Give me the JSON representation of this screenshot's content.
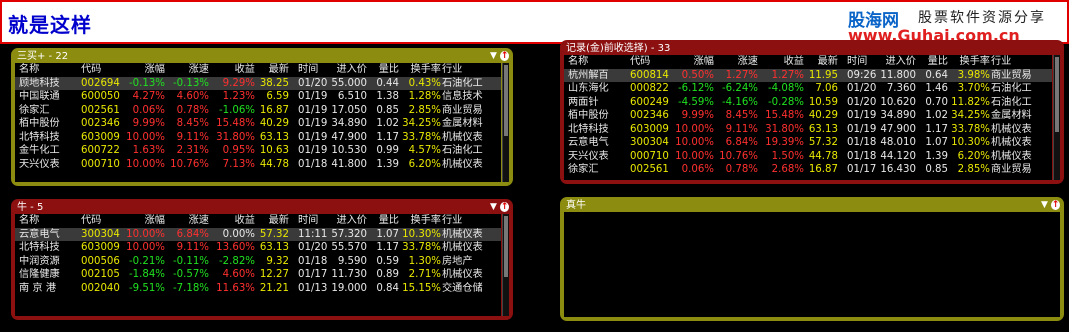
{
  "title": "就是这样",
  "watermark": {
    "logo": "股海网",
    "tagline": "股票软件资源分享",
    "url": "www.Guhai.com.cn"
  },
  "headers": [
    "名称",
    "代码",
    "涨幅",
    "涨速",
    "收益",
    "最新",
    "时间",
    "进入价",
    "量比",
    "换手率",
    "行业"
  ],
  "colors": {
    "up": "#ff3030",
    "down": "#20e020",
    "code": "#e8e800",
    "panel1": "#8c8c10",
    "panel2": "#8c1010"
  },
  "panels": {
    "p1": {
      "name": "三买+ - 22",
      "rows": [
        {
          "n": "顾地科技",
          "c": "002694",
          "z": "-0.13%",
          "s": "-0.13%",
          "y": "9.29%",
          "l": "38.25",
          "t": "01/20",
          "j": "55.000",
          "b": "0.44",
          "h": "0.43%",
          "i": "石油化工"
        },
        {
          "n": "中国联通",
          "c": "600050",
          "z": "4.27%",
          "s": "4.60%",
          "y": "1.23%",
          "l": "6.59",
          "t": "01/19",
          "j": "6.510",
          "b": "1.38",
          "h": "1.28%",
          "i": "信息技术"
        },
        {
          "n": "徐家汇",
          "c": "002561",
          "z": "0.06%",
          "s": "0.78%",
          "y": "-1.06%",
          "l": "16.87",
          "t": "01/19",
          "j": "17.050",
          "b": "0.85",
          "h": "2.85%",
          "i": "商业贸易"
        },
        {
          "n": "栢中股份",
          "c": "002346",
          "z": "9.99%",
          "s": "8.45%",
          "y": "15.48%",
          "l": "40.29",
          "t": "01/19",
          "j": "34.890",
          "b": "1.02",
          "h": "34.25%",
          "i": "金属材料"
        },
        {
          "n": "北特科技",
          "c": "603009",
          "z": "10.00%",
          "s": "9.11%",
          "y": "31.80%",
          "l": "63.13",
          "t": "01/19",
          "j": "47.900",
          "b": "1.17",
          "h": "33.78%",
          "i": "机械仪表"
        },
        {
          "n": "金牛化工",
          "c": "600722",
          "z": "1.63%",
          "s": "2.31%",
          "y": "0.95%",
          "l": "10.63",
          "t": "01/19",
          "j": "10.530",
          "b": "0.99",
          "h": "4.57%",
          "i": "石油化工"
        },
        {
          "n": "天兴仪表",
          "c": "000710",
          "z": "10.00%",
          "s": "10.76%",
          "y": "7.13%",
          "l": "44.78",
          "t": "01/18",
          "j": "41.800",
          "b": "1.39",
          "h": "6.20%",
          "i": "机械仪表"
        }
      ]
    },
    "p2": {
      "name": "牛 - 5",
      "rows": [
        {
          "n": "云意电气",
          "c": "300304",
          "z": "10.00%",
          "s": "6.84%",
          "y": "0.00%",
          "l": "57.32",
          "t": "11:11",
          "j": "57.320",
          "b": "1.07",
          "h": "10.30%",
          "i": "机械仪表"
        },
        {
          "n": "北特科技",
          "c": "603009",
          "z": "10.00%",
          "s": "9.11%",
          "y": "13.60%",
          "l": "63.13",
          "t": "01/20",
          "j": "55.570",
          "b": "1.17",
          "h": "33.78%",
          "i": "机械仪表"
        },
        {
          "n": "中润资源",
          "c": "000506",
          "z": "-0.21%",
          "s": "-0.11%",
          "y": "-2.82%",
          "l": "9.32",
          "t": "01/18",
          "j": "9.590",
          "b": "0.59",
          "h": "1.30%",
          "i": "房地产"
        },
        {
          "n": "信隆健康",
          "c": "002105",
          "z": "-1.84%",
          "s": "-0.57%",
          "y": "4.60%",
          "l": "12.27",
          "t": "01/17",
          "j": "11.730",
          "b": "0.89",
          "h": "2.71%",
          "i": "机械仪表"
        },
        {
          "n": "南 京 港",
          "c": "002040",
          "z": "-9.51%",
          "s": "-7.18%",
          "y": "11.63%",
          "l": "21.21",
          "t": "01/13",
          "j": "19.000",
          "b": "0.84",
          "h": "15.15%",
          "i": "交通仓储"
        }
      ]
    },
    "p3": {
      "name": "记录(金)前收选择) - 33",
      "rows": [
        {
          "n": "杭州解百",
          "c": "600814",
          "z": "0.50%",
          "s": "1.27%",
          "y": "1.27%",
          "l": "11.95",
          "t": "09:26",
          "j": "11.800",
          "b": "0.64",
          "h": "3.98%",
          "i": "商业贸易"
        },
        {
          "n": "山东海化",
          "c": "000822",
          "z": "-6.12%",
          "s": "-6.24%",
          "y": "-4.08%",
          "l": "7.06",
          "t": "01/20",
          "j": "7.360",
          "b": "1.46",
          "h": "3.70%",
          "i": "石油化工"
        },
        {
          "n": "两面针",
          "c": "600249",
          "z": "-4.59%",
          "s": "-4.16%",
          "y": "-0.28%",
          "l": "10.59",
          "t": "01/20",
          "j": "10.620",
          "b": "0.70",
          "h": "11.82%",
          "i": "石油化工"
        },
        {
          "n": "栢中股份",
          "c": "002346",
          "z": "9.99%",
          "s": "8.45%",
          "y": "15.48%",
          "l": "40.29",
          "t": "01/19",
          "j": "34.890",
          "b": "1.02",
          "h": "34.25%",
          "i": "金属材料"
        },
        {
          "n": "北特科技",
          "c": "603009",
          "z": "10.00%",
          "s": "9.11%",
          "y": "31.80%",
          "l": "63.13",
          "t": "01/19",
          "j": "47.900",
          "b": "1.17",
          "h": "33.78%",
          "i": "机械仪表"
        },
        {
          "n": "云意电气",
          "c": "300304",
          "z": "10.00%",
          "s": "6.84%",
          "y": "19.39%",
          "l": "57.32",
          "t": "01/18",
          "j": "48.010",
          "b": "1.07",
          "h": "10.30%",
          "i": "机械仪表"
        },
        {
          "n": "天兴仪表",
          "c": "000710",
          "z": "10.00%",
          "s": "10.76%",
          "y": "1.50%",
          "l": "44.78",
          "t": "01/18",
          "j": "44.120",
          "b": "1.39",
          "h": "6.20%",
          "i": "机械仪表"
        },
        {
          "n": "徐家汇",
          "c": "002561",
          "z": "0.06%",
          "s": "0.78%",
          "y": "2.68%",
          "l": "16.87",
          "t": "01/17",
          "j": "16.430",
          "b": "0.85",
          "h": "2.85%",
          "i": "商业贸易"
        }
      ]
    },
    "p4": {
      "name": "真牛",
      "rows": []
    }
  }
}
